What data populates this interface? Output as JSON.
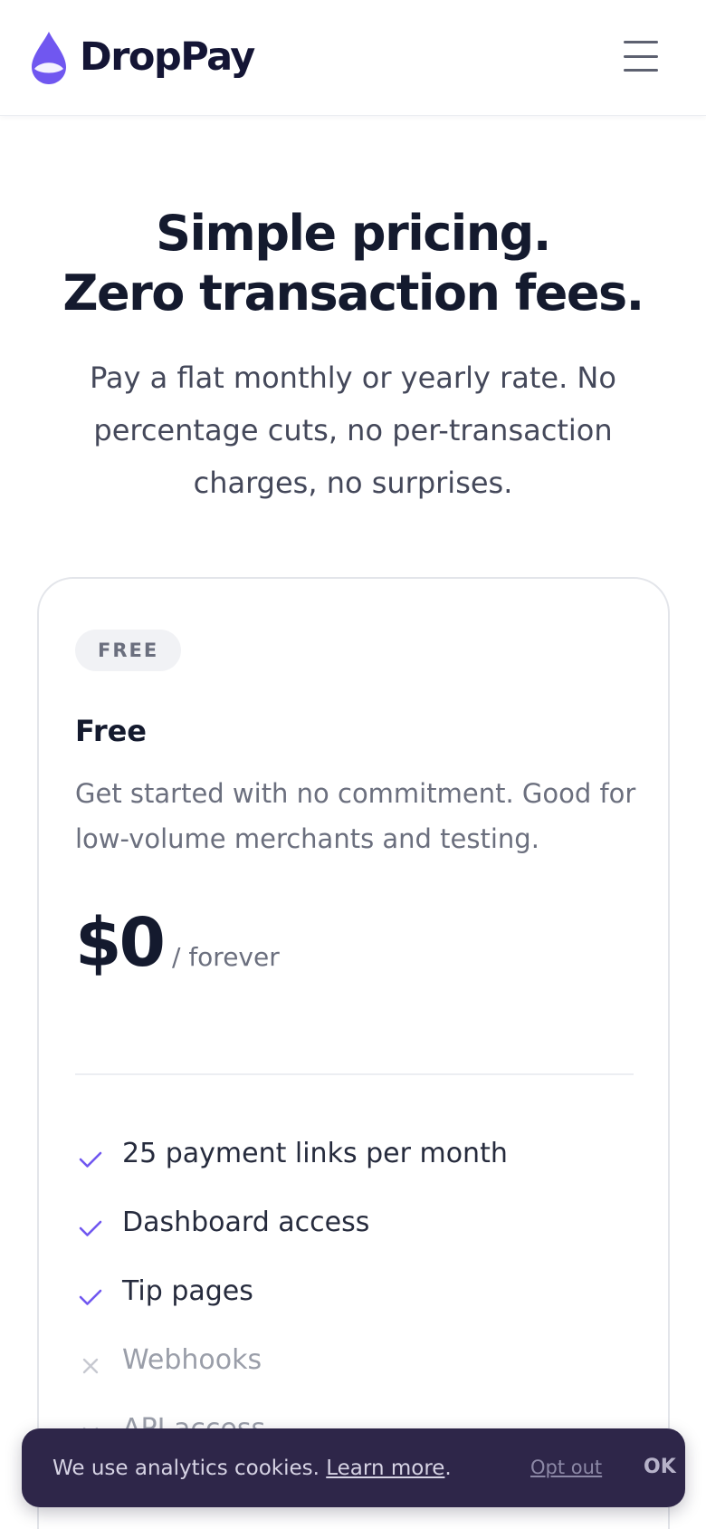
{
  "brand": {
    "name": "DropPay",
    "accent_color": "#7057f0"
  },
  "header": {
    "menu_icon": "hamburger-menu-icon"
  },
  "hero": {
    "title_line1": "Simple pricing.",
    "title_line2": "Zero transaction fees.",
    "subtitle": "Pay a flat monthly or yearly rate. No percentage cuts, no per-transaction charges, no surprises."
  },
  "plan": {
    "badge": "FREE",
    "name": "Free",
    "description": "Get started with no commitment. Good for low-volume merchants and testing.",
    "price": "$0",
    "period": "/ forever",
    "features": [
      {
        "label": "25 payment links per month",
        "included": true,
        "icon": "check-icon"
      },
      {
        "label": "Dashboard access",
        "included": true,
        "icon": "check-icon"
      },
      {
        "label": "Tip pages",
        "included": true,
        "icon": "check-icon"
      },
      {
        "label": "Webhooks",
        "included": false,
        "icon": "x-icon"
      },
      {
        "label": "API access",
        "included": false,
        "icon": "x-icon"
      }
    ]
  },
  "cookie_banner": {
    "message": "We use analytics cookies.",
    "learn_more": "Learn more",
    "period": ".",
    "opt_out": "Opt out",
    "ok": "OK"
  }
}
